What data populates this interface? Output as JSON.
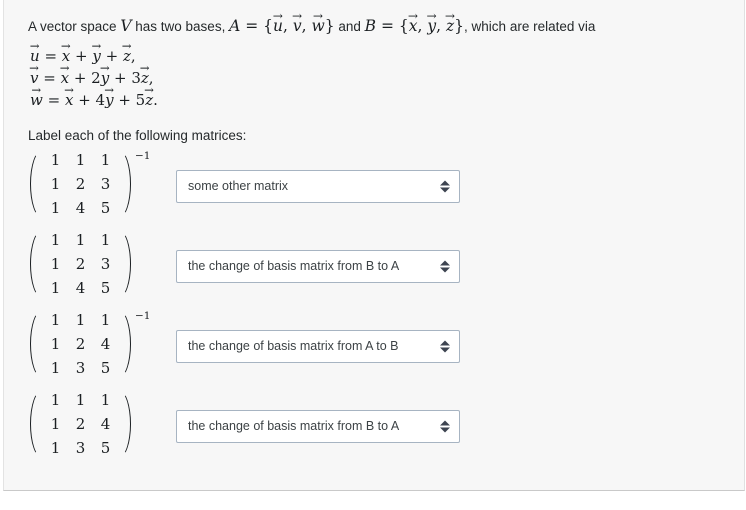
{
  "problem": {
    "intro": {
      "part1": "A vector space ",
      "v": "V",
      "part2": " has two bases, ",
      "a": "A",
      "eq1": " = ",
      "setA_open": "{",
      "setA_u": "u",
      "setA_c1": ", ",
      "setA_v": "v",
      "setA_c2": ", ",
      "setA_w": "w",
      "setA_close": "}",
      "part3": " and ",
      "b": "B",
      "eq2": " = ",
      "setB_open": "{",
      "setB_x": "x",
      "setB_c1": ", ",
      "setB_y": "y",
      "setB_c2": ", ",
      "setB_z": "z",
      "setB_close": "}",
      "part4": ", which are related via"
    },
    "equations": [
      {
        "lhs": "u",
        "rel": " = ",
        "t1_coef": "",
        "t1_var": "x",
        "op1": " + ",
        "t2_coef": "",
        "t2_var": "y",
        "op2": " + ",
        "t3_coef": "",
        "t3_var": "z",
        "end": ","
      },
      {
        "lhs": "v",
        "rel": " = ",
        "t1_coef": "",
        "t1_var": "x",
        "op1": " + ",
        "t2_coef": "2",
        "t2_var": "y",
        "op2": " + ",
        "t3_coef": "3",
        "t3_var": "z",
        "end": ","
      },
      {
        "lhs": "w",
        "rel": " = ",
        "t1_coef": "",
        "t1_var": "x",
        "op1": " + ",
        "t2_coef": "4",
        "t2_var": "y",
        "op2": " + ",
        "t3_coef": "5",
        "t3_var": "z",
        "end": "."
      }
    ],
    "instruction": "Label each of the following matrices:",
    "arrow_glyph": "→"
  },
  "items": [
    {
      "matrix": {
        "rows": [
          [
            "1",
            "1",
            "1"
          ],
          [
            "1",
            "2",
            "3"
          ],
          [
            "1",
            "4",
            "5"
          ]
        ],
        "exponent": "−1"
      },
      "select": {
        "value": "some other matrix",
        "options": [
          "the change of basis matrix from A to B",
          "the change of basis matrix from B to A",
          "some other matrix"
        ]
      }
    },
    {
      "matrix": {
        "rows": [
          [
            "1",
            "1",
            "1"
          ],
          [
            "1",
            "2",
            "3"
          ],
          [
            "1",
            "4",
            "5"
          ]
        ],
        "exponent": ""
      },
      "select": {
        "value": "the change of basis matrix from B to A",
        "options": [
          "the change of basis matrix from A to B",
          "the change of basis matrix from B to A",
          "some other matrix"
        ]
      }
    },
    {
      "matrix": {
        "rows": [
          [
            "1",
            "1",
            "1"
          ],
          [
            "1",
            "2",
            "4"
          ],
          [
            "1",
            "3",
            "5"
          ]
        ],
        "exponent": "−1"
      },
      "select": {
        "value": "the change of basis matrix from A to B",
        "options": [
          "the change of basis matrix from A to B",
          "the change of basis matrix from B to A",
          "some other matrix"
        ]
      }
    },
    {
      "matrix": {
        "rows": [
          [
            "1",
            "1",
            "1"
          ],
          [
            "1",
            "2",
            "4"
          ],
          [
            "1",
            "3",
            "5"
          ]
        ],
        "exponent": ""
      },
      "select": {
        "value": "the change of basis matrix from B to A",
        "options": [
          "the change of basis matrix from A to B",
          "the change of basis matrix from B to A",
          "some other matrix"
        ]
      }
    }
  ]
}
